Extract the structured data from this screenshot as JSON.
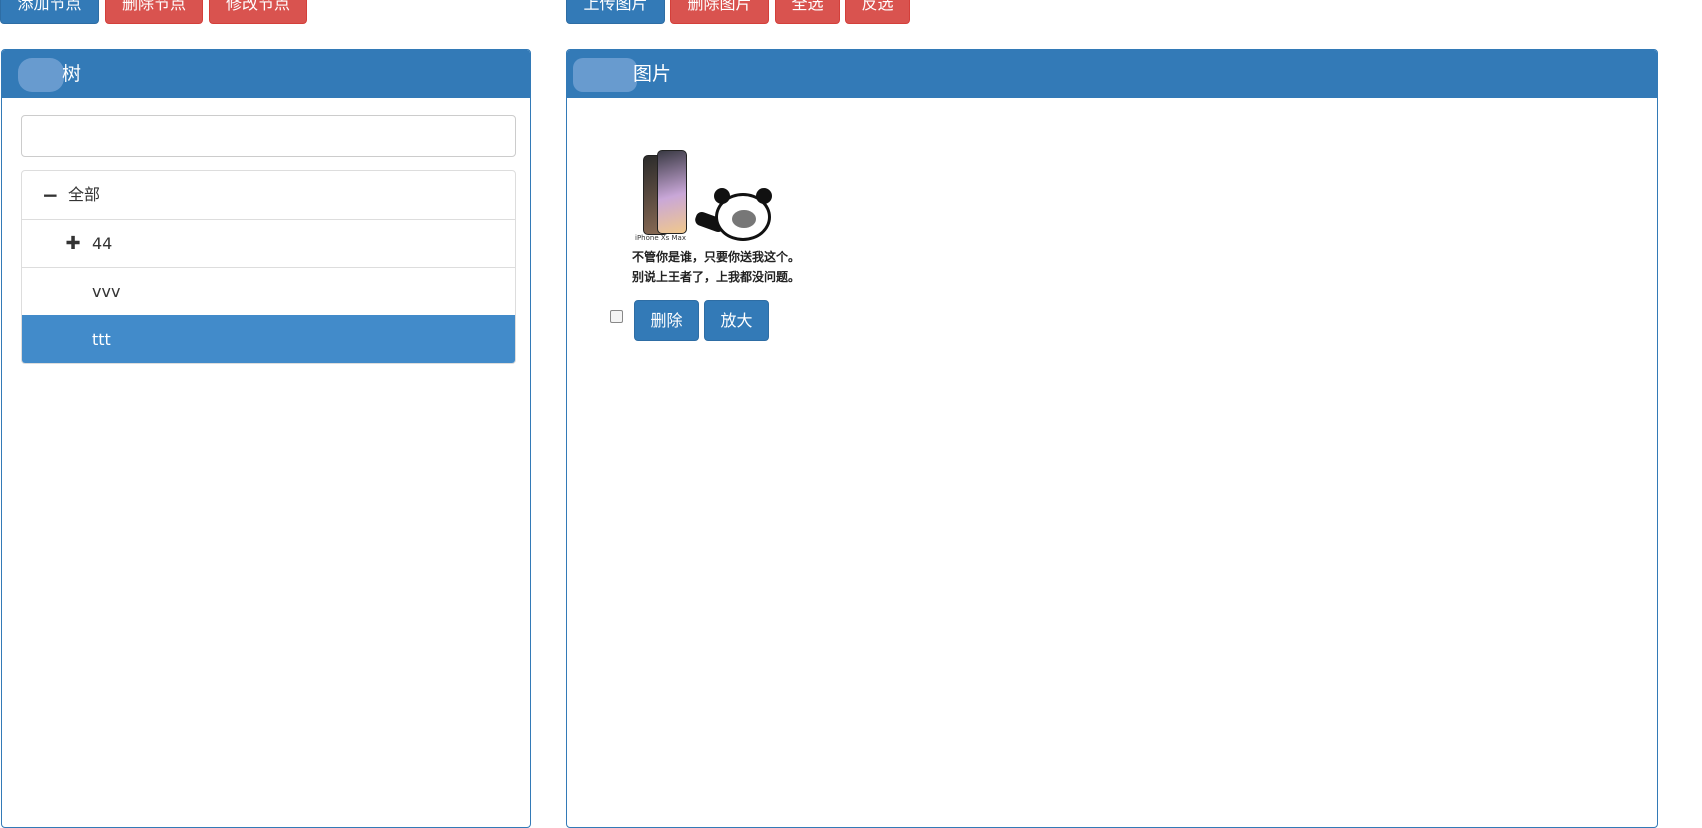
{
  "toolbar_left": {
    "add_node": "添加节点",
    "delete_node": "删除节点",
    "edit_node": "修改节点"
  },
  "toolbar_right": {
    "upload_image": "上传图片",
    "delete_image": "删除图片",
    "select_all": "全选",
    "invert_select": "反选"
  },
  "tree_panel": {
    "title": "树",
    "search_value": "",
    "nodes": [
      {
        "label": "全部",
        "toggle": "−",
        "level": 0,
        "expanded": true
      },
      {
        "label": "44",
        "toggle": "✚",
        "level": 1,
        "expanded": false
      },
      {
        "label": "vvv",
        "toggle": "",
        "level": 1
      },
      {
        "label": "ttt",
        "toggle": "",
        "level": 1,
        "selected": true
      }
    ]
  },
  "image_panel": {
    "title": "图片",
    "images": [
      {
        "phone_caption": "iPhone Xs Max",
        "caption_line1": "不管你是谁，只要你送我这个。",
        "caption_line2": "别说上王者了，上我都没问题。",
        "checked": false,
        "delete_label": "删除",
        "zoom_label": "放大"
      }
    ]
  },
  "colors": {
    "primary": "#337ab7",
    "danger": "#d9534f",
    "selected_node": "#428bca"
  }
}
